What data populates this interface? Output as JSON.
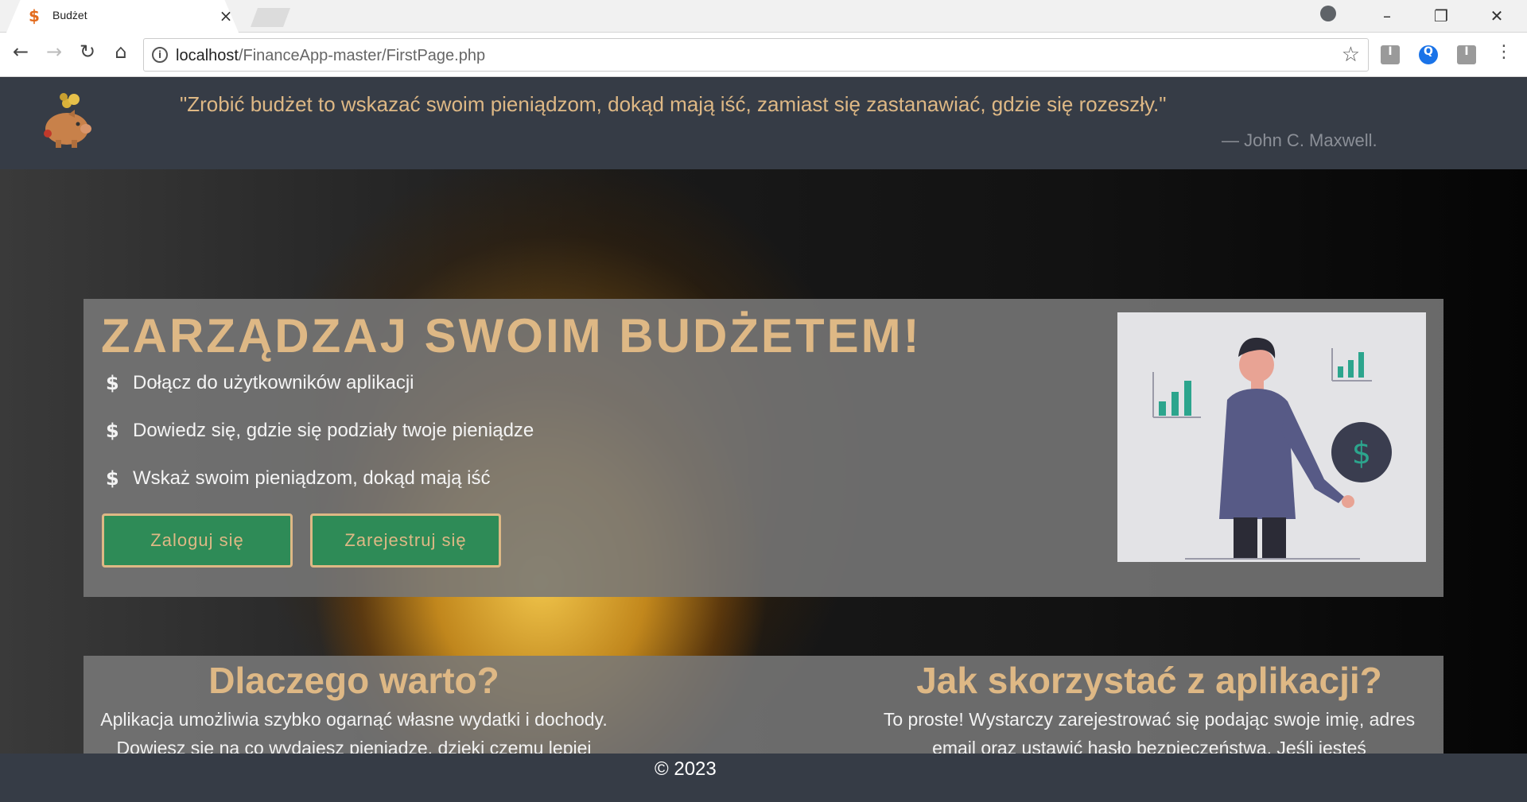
{
  "browser": {
    "tab_title": "Budżet",
    "tab_favicon": "$",
    "url_host": "localhost",
    "url_path": "/FinanceApp-master/FirstPage.php"
  },
  "header": {
    "quote": "\"Zrobić budżet to wskazać swoim pieniądzom, dokąd mają iść, zamiast się zastanawiać, gdzie się rozeszły.\"",
    "author": "— John C. Maxwell."
  },
  "hero": {
    "headline": "ZARZĄDZAJ SWOIM BUDŻETEM!",
    "bullet_symbol": "$",
    "bullets": [
      "Dołącz do użytkowników aplikacji",
      "Dowiedz się, gdzie się podziały twoje pieniądze",
      "Wskaż swoim pieniądzom, dokąd mają iść"
    ],
    "login_label": "Zaloguj się",
    "register_label": "Zarejestruj się"
  },
  "info": {
    "why_title": "Dlaczego warto?",
    "why_text": "Aplikacja umożliwia szybko ogarnąć własne wydatki i dochody. Dowiesz się na co wydajesz pieniądze, dzięki czemu lepiej będziesz mógł je gospodarować.",
    "how_title": "Jak skorzystać z aplikacji?",
    "how_text": "To proste! Wystarczy zarejestrować się podając swoje imię, adres email oraz ustawić hasło bezpieczeństwa. Jeśli jesteś zarejestrowany, kliknij przycisk \"Zaloguj się\"."
  },
  "footer": {
    "copyright": "© 2023"
  },
  "colors": {
    "accent_gold": "#deb885",
    "button_green": "#2e8b57",
    "header_bg": "#363c46"
  }
}
